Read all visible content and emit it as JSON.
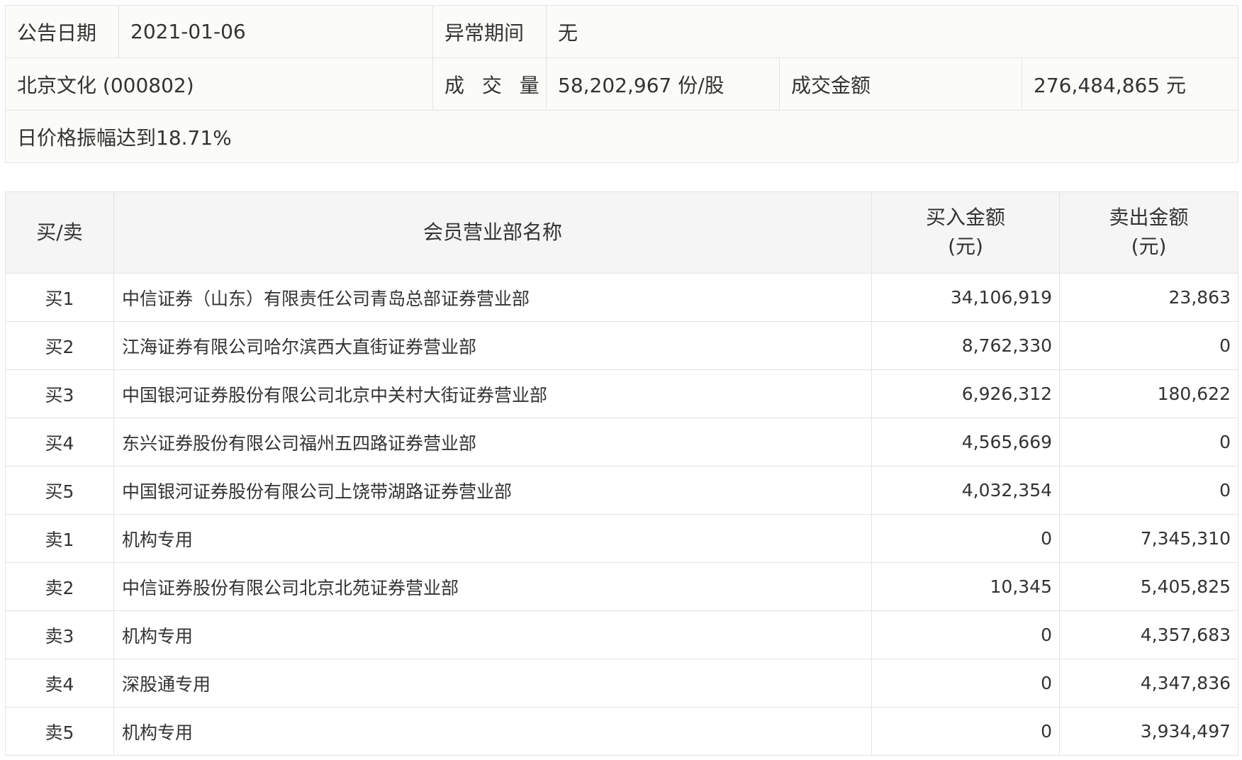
{
  "summary": {
    "announce_label": "公告日期",
    "announce_value": "2021-01-06",
    "period_label": "异常期间",
    "period_value": "无",
    "stock": "北京文化 (000802)",
    "volume_label": "成 交 量",
    "volume_value": "58,202,967 份/股",
    "amount_label": "成交金额",
    "amount_value": "276,484,865 元",
    "reason": "日价格振幅达到18.71%"
  },
  "table": {
    "headers": {
      "side": "买/卖",
      "member": "会员营业部名称",
      "buy_line1": "买入金额",
      "buy_line2": "(元)",
      "sell_line1": "卖出金额",
      "sell_line2": "(元)"
    },
    "rows": [
      {
        "rank": "买1",
        "name": "中信证券（山东）有限责任公司青岛总部证券营业部",
        "buy": "34,106,919",
        "sell": "23,863"
      },
      {
        "rank": "买2",
        "name": "江海证券有限公司哈尔滨西大直街证券营业部",
        "buy": "8,762,330",
        "sell": "0"
      },
      {
        "rank": "买3",
        "name": "中国银河证券股份有限公司北京中关村大街证券营业部",
        "buy": "6,926,312",
        "sell": "180,622"
      },
      {
        "rank": "买4",
        "name": "东兴证券股份有限公司福州五四路证券营业部",
        "buy": "4,565,669",
        "sell": "0"
      },
      {
        "rank": "买5",
        "name": "中国银河证券股份有限公司上饶带湖路证券营业部",
        "buy": "4,032,354",
        "sell": "0"
      },
      {
        "rank": "卖1",
        "name": "机构专用",
        "buy": "0",
        "sell": "7,345,310"
      },
      {
        "rank": "卖2",
        "name": "中信证券股份有限公司北京北苑证券营业部",
        "buy": "10,345",
        "sell": "5,405,825"
      },
      {
        "rank": "卖3",
        "name": "机构专用",
        "buy": "0",
        "sell": "4,357,683"
      },
      {
        "rank": "卖4",
        "name": "深股通专用",
        "buy": "0",
        "sell": "4,347,836"
      },
      {
        "rank": "卖5",
        "name": "机构专用",
        "buy": "0",
        "sell": "3,934,497"
      }
    ]
  }
}
